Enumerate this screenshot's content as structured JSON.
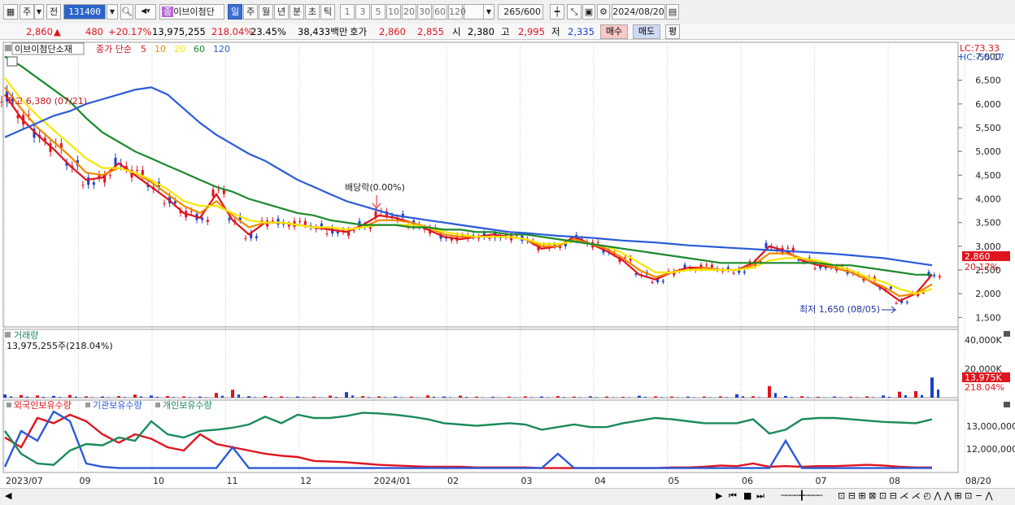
{
  "toolbar": {
    "period_mode": "주",
    "prev_label": "전",
    "code": "131400",
    "stock_name": "이브이첨단",
    "period_tabs": [
      "일",
      "주",
      "월",
      "년",
      "분",
      "초",
      "틱"
    ],
    "active_tab": "일",
    "intervals": [
      "1",
      "3",
      "5",
      "10",
      "20",
      "30",
      "60",
      "120"
    ],
    "count": "265",
    "count_total": "/600",
    "date": "2024/08/20"
  },
  "quote": {
    "price": "2,860",
    "change_arrow": "▲",
    "change": "480",
    "change_pct": "+20.17%",
    "volume": "13,975,255",
    "vol_ratio": "218.04%",
    "turnover": "23.45%",
    "amount": "38,433백만",
    "hoga_label": "호가",
    "hoga_sell": "2,860",
    "hoga_buy": "2,855",
    "open_label": "시",
    "open": "2,380",
    "high_label": "고",
    "high": "2,995",
    "low_label": "저",
    "low": "2,335",
    "buy_btn": "매수",
    "sell_btn": "매도",
    "eval_btn": "평"
  },
  "price_panel": {
    "name": "이브이첨단소재",
    "ma_label": "종가 단순",
    "ma_periods": [
      "5",
      "10",
      "20",
      "60",
      "120"
    ],
    "ma_colors": [
      "#e0141e",
      "#f08a00",
      "#f7e600",
      "#1a8a2a",
      "#2a5ad8"
    ],
    "lc": "LC:73.33",
    "hc": "HC:-55.17",
    "high_annot": "최고 6,380 (07/21)",
    "low_annot": "최저 1,650 (08/05)",
    "dividend_annot": "배당락(0.00%)",
    "last_price_tag": "2,860",
    "last_pct_tag": "20.17%"
  },
  "volume_panel": {
    "title": "거래량",
    "info": "13,975,255주(218.04%)",
    "last_tag": "13,975K",
    "last_pct": "218.04%"
  },
  "holdings_panel": {
    "legend": [
      "외국인보유수량",
      "기관보유수량",
      "개인보유수량"
    ],
    "colors": [
      "#e0141e",
      "#2a5ad8",
      "#1a8a5a"
    ]
  },
  "chart_data": [
    {
      "type": "candlestick",
      "title": "이브이첨단소재",
      "y_ticks": [
        1500,
        2000,
        2500,
        3000,
        3500,
        4000,
        4500,
        5000,
        5500,
        6000,
        6500,
        7000
      ],
      "ylim": [
        1300,
        7300
      ],
      "x_ticks": [
        "2023/07",
        "09",
        "10",
        "11",
        "12",
        "2024/01",
        "02",
        "03",
        "04",
        "05",
        "06",
        "07",
        "08",
        "08/20"
      ],
      "series": [
        {
          "name": "5",
          "values": [
            6200,
            5700,
            5350,
            5050,
            4700,
            4400,
            4450,
            4750,
            4500,
            4250,
            4000,
            3700,
            3600,
            4100,
            3550,
            3250,
            3500,
            3500,
            3450,
            3400,
            3350,
            3300,
            3450,
            3650,
            3600,
            3500,
            3350,
            3200,
            3150,
            3200,
            3250,
            3200,
            3150,
            2950,
            3000,
            3200,
            3050,
            2900,
            2700,
            2400,
            2300,
            2450,
            2550,
            2550,
            2500,
            2500,
            2650,
            3000,
            2900,
            2700,
            2600,
            2550,
            2450,
            2300,
            2100,
            1850,
            2000,
            2400
          ]
        },
        {
          "name": "10",
          "values": [
            6350,
            5900,
            5500,
            5200,
            4900,
            4550,
            4500,
            4650,
            4550,
            4350,
            4100,
            3850,
            3700,
            3950,
            3650,
            3400,
            3500,
            3500,
            3450,
            3400,
            3400,
            3350,
            3400,
            3550,
            3550,
            3500,
            3400,
            3250,
            3200,
            3200,
            3200,
            3200,
            3150,
            3000,
            3000,
            3150,
            3050,
            2950,
            2750,
            2500,
            2350,
            2450,
            2500,
            2550,
            2500,
            2500,
            2600,
            2850,
            2850,
            2750,
            2650,
            2550,
            2450,
            2300,
            2150,
            1950,
            2000,
            2200
          ]
        },
        {
          "name": "20",
          "values": [
            6550,
            6100,
            5750,
            5450,
            5150,
            4850,
            4650,
            4650,
            4550,
            4400,
            4200,
            3950,
            3850,
            3850,
            3700,
            3550,
            3500,
            3500,
            3450,
            3400,
            3400,
            3350,
            3400,
            3450,
            3450,
            3450,
            3400,
            3300,
            3250,
            3200,
            3200,
            3200,
            3150,
            3050,
            3050,
            3100,
            3050,
            3000,
            2850,
            2650,
            2450,
            2450,
            2500,
            2500,
            2500,
            2500,
            2550,
            2700,
            2750,
            2750,
            2700,
            2600,
            2500,
            2350,
            2250,
            2100,
            2000,
            2100
          ]
        },
        {
          "name": "60",
          "values": [
            7000,
            6800,
            6550,
            6300,
            6050,
            5700,
            5400,
            5200,
            5000,
            4850,
            4700,
            4550,
            4400,
            4250,
            4150,
            4000,
            3900,
            3800,
            3700,
            3650,
            3550,
            3500,
            3450,
            3450,
            3450,
            3400,
            3400,
            3350,
            3350,
            3300,
            3300,
            3250,
            3250,
            3200,
            3150,
            3100,
            3050,
            3000,
            2950,
            2900,
            2850,
            2800,
            2750,
            2700,
            2650,
            2650,
            2650,
            2650,
            2650,
            2650,
            2650,
            2600,
            2600,
            2550,
            2500,
            2450,
            2400,
            2400
          ]
        },
        {
          "name": "120",
          "values": [
            5300,
            5450,
            5600,
            5750,
            5850,
            6000,
            6100,
            6200,
            6300,
            6350,
            6200,
            5900,
            5600,
            5350,
            5150,
            4950,
            4800,
            4600,
            4400,
            4250,
            4100,
            3950,
            3850,
            3750,
            3650,
            3600,
            3550,
            3500,
            3450,
            3400,
            3350,
            3300,
            3280,
            3250,
            3220,
            3200,
            3180,
            3150,
            3120,
            3100,
            3080,
            3050,
            3020,
            3000,
            2980,
            2960,
            2940,
            2920,
            2900,
            2880,
            2860,
            2840,
            2810,
            2780,
            2750,
            2700,
            2650,
            2600
          ]
        }
      ],
      "annotations": [
        {
          "text": "최고 6,380 (07/21)",
          "value": 6380
        },
        {
          "text": "최저 1,650 (08/05)",
          "value": 1650
        },
        {
          "text": "배당락(0.00%)"
        }
      ]
    },
    {
      "type": "bar",
      "title": "거래량",
      "y_ticks": [
        "20,000K",
        "40,000K"
      ],
      "ylim": [
        0,
        45000
      ],
      "values": [
        2200,
        1800,
        1500,
        1200,
        1900,
        900,
        800,
        1100,
        2100,
        1500,
        1100,
        900,
        700,
        3300,
        5500,
        1000,
        1200,
        900,
        800,
        700,
        1400,
        3800,
        1100,
        900,
        800,
        700,
        1600,
        800,
        1400,
        700,
        600,
        700,
        900,
        800,
        1100,
        700,
        900,
        800,
        600,
        1300,
        900,
        800,
        700,
        800,
        900,
        2400,
        1000,
        8000,
        1100,
        1000,
        600,
        800,
        700,
        900,
        1500,
        4100,
        4500,
        13975
      ]
    },
    {
      "type": "line",
      "title": "외국인보유수량 / 기관보유수량 / 개인보유수량",
      "y_ticks": [
        "12,000,000",
        "13,000,000"
      ],
      "series": [
        {
          "name": "외국인보유수량",
          "values": [
            0.5,
            0.35,
            0.8,
            0.72,
            0.85,
            0.75,
            0.55,
            0.42,
            0.55,
            0.48,
            0.35,
            0.3,
            0.55,
            0.4,
            0.35,
            0.3,
            0.25,
            0.22,
            0.2,
            0.14,
            0.13,
            0.12,
            0.1,
            0.08,
            0.07,
            0.06,
            0.05,
            0.05,
            0.05,
            0.04,
            0.04,
            0.04,
            0.04,
            0.03,
            0.03,
            0.03,
            0.03,
            0.03,
            0.03,
            0.03,
            0.03,
            0.04,
            0.04,
            0.05,
            0.07,
            0.06,
            0.1,
            0.05,
            0.06,
            0.05,
            0.06,
            0.06,
            0.07,
            0.08,
            0.07,
            0.05,
            0.04,
            0.04
          ]
        },
        {
          "name": "기관보유수량",
          "values": [
            0.05,
            0.6,
            0.45,
            0.9,
            0.75,
            0.1,
            0.05,
            0.03,
            0.03,
            0.03,
            0.03,
            0.03,
            0.03,
            0.03,
            0.35,
            0.03,
            0.03,
            0.03,
            0.03,
            0.03,
            0.03,
            0.03,
            0.03,
            0.03,
            0.03,
            0.03,
            0.03,
            0.03,
            0.03,
            0.03,
            0.03,
            0.03,
            0.03,
            0.03,
            0.25,
            0.03,
            0.03,
            0.03,
            0.03,
            0.03,
            0.03,
            0.03,
            0.03,
            0.03,
            0.03,
            0.03,
            0.03,
            0.03,
            0.45,
            0.03,
            0.03,
            0.03,
            0.03,
            0.03,
            0.03,
            0.03,
            0.03,
            0.03
          ]
        },
        {
          "name": "개인보유수량",
          "values": [
            0.6,
            0.25,
            0.1,
            0.08,
            0.3,
            0.4,
            0.38,
            0.5,
            0.45,
            0.75,
            0.55,
            0.5,
            0.6,
            0.62,
            0.65,
            0.7,
            0.82,
            0.72,
            0.85,
            0.8,
            0.8,
            0.83,
            0.88,
            0.87,
            0.85,
            0.82,
            0.78,
            0.72,
            0.7,
            0.68,
            0.7,
            0.72,
            0.7,
            0.62,
            0.66,
            0.7,
            0.66,
            0.66,
            0.72,
            0.76,
            0.8,
            0.78,
            0.75,
            0.72,
            0.72,
            0.72,
            0.78,
            0.56,
            0.62,
            0.78,
            0.8,
            0.8,
            0.78,
            0.76,
            0.74,
            0.73,
            0.72,
            0.78
          ]
        }
      ]
    }
  ]
}
